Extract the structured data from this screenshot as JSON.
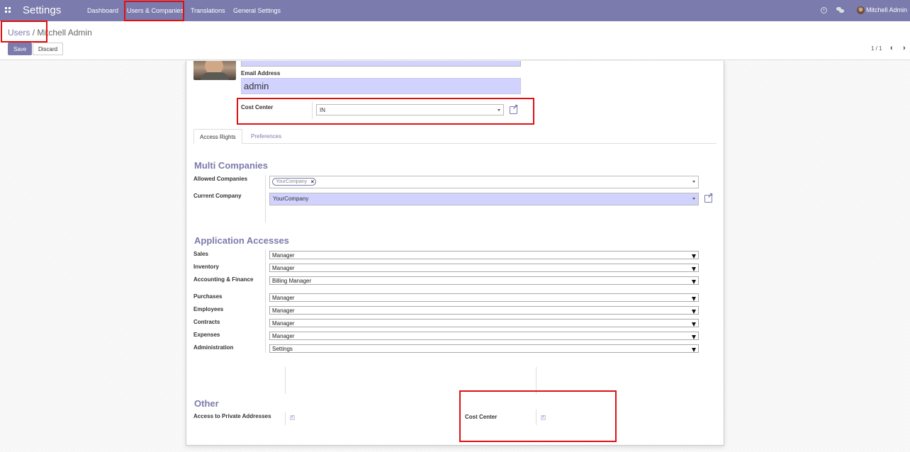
{
  "navbar": {
    "app_title": "Settings",
    "menu": [
      "Dashboard",
      "Users & Companies",
      "Translations",
      "General Settings"
    ],
    "user_name": "Mitchell Admin"
  },
  "breadcrumb": {
    "parent": "Users",
    "separator": "/",
    "current": "Mitchell Admin"
  },
  "buttons": {
    "save": "Save",
    "discard": "Discard"
  },
  "pager": {
    "value": "1 / 1"
  },
  "form": {
    "email_label": "Email Address",
    "email_value": "admin",
    "cost_center_label": "Cost Center",
    "cost_center_value": "IN"
  },
  "tabs": [
    "Access Rights",
    "Preferences"
  ],
  "multi_companies": {
    "title": "Multi Companies",
    "allowed_label": "Allowed Companies",
    "allowed_tag": "YourCompany",
    "current_label": "Current Company",
    "current_value": "YourCompany"
  },
  "application_accesses": {
    "title": "Application Accesses",
    "rows": [
      {
        "label": "Sales",
        "value": "Manager"
      },
      {
        "label": "Inventory",
        "value": "Manager"
      },
      {
        "label": "Accounting & Finance",
        "value": "Billing Manager"
      },
      {
        "label": "Purchases",
        "value": "Manager"
      },
      {
        "label": "Employees",
        "value": "Manager"
      },
      {
        "label": "Contracts",
        "value": "Manager"
      },
      {
        "label": "Expenses",
        "value": "Manager"
      },
      {
        "label": "Administration",
        "value": "Settings"
      }
    ]
  },
  "other": {
    "title": "Other",
    "private_addresses_label": "Access to Private Addresses",
    "private_addresses_checked": true,
    "cost_center_label": "Cost Center",
    "cost_center_checked": true
  },
  "colors": {
    "brand": "#7c7bad",
    "highlight_field": "#d2d2ff",
    "annotation": "#e01010"
  },
  "icons": [
    "apps-grid-icon",
    "clock-icon",
    "chat-icon",
    "external-link-icon",
    "chevron-left-icon",
    "chevron-right-icon",
    "remove-tag-icon"
  ]
}
